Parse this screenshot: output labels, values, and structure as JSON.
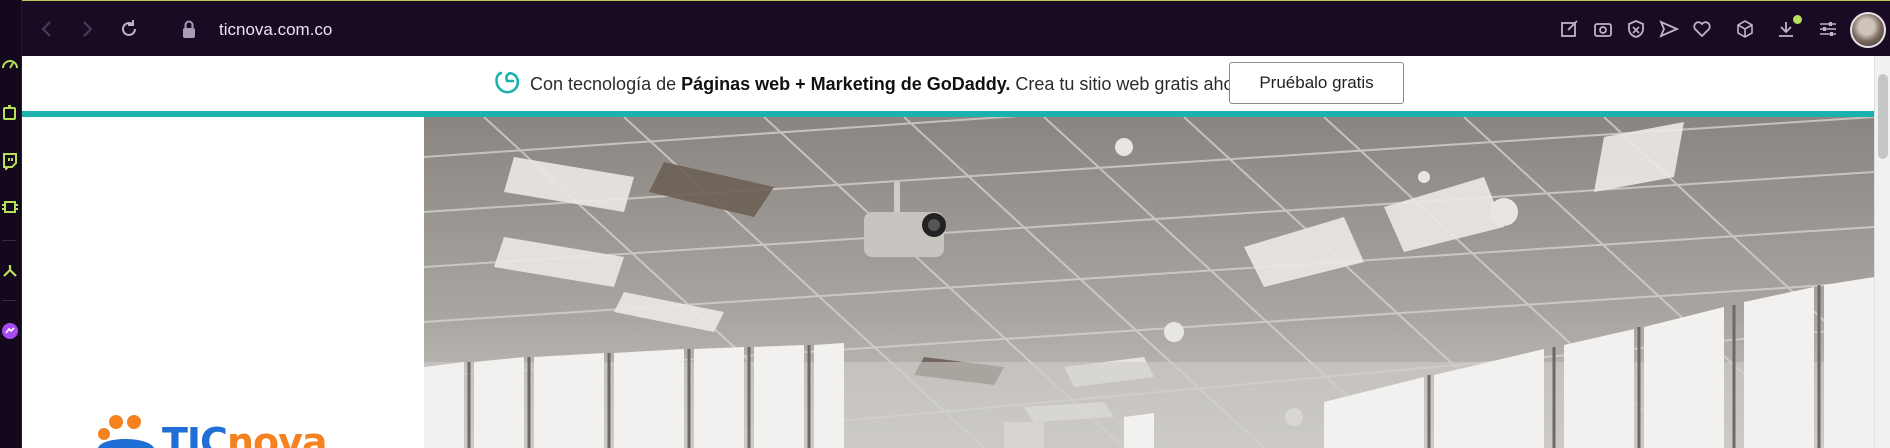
{
  "browser": {
    "url": "ticnova.com.co",
    "nav_icons": [
      "back-icon",
      "forward-icon",
      "reload-icon",
      "lock-icon"
    ],
    "right_icons": [
      "edit-icon",
      "camera-icon",
      "shield-icon",
      "send-icon",
      "heart-icon",
      "cube-icon",
      "download-icon",
      "settings-sliders-icon"
    ],
    "sidebar_icons": [
      "speedometer-icon",
      "battery-icon",
      "twitch-icon",
      "chip-icon",
      "tree-icon",
      "messenger-icon"
    ]
  },
  "banner": {
    "prefix": "Con tecnología de ",
    "bold": "Páginas web + Marketing de GoDaddy.",
    "suffix": " Crea tu sitio web gratis ahora.",
    "button": "Pruébalo gratis"
  },
  "site": {
    "logo_tic": "TIC",
    "logo_nova": "nova"
  },
  "colors": {
    "accent": "#1bb2ad",
    "browser_bg": "#1a0b24",
    "sidebar_icon": "#b6e05a"
  }
}
